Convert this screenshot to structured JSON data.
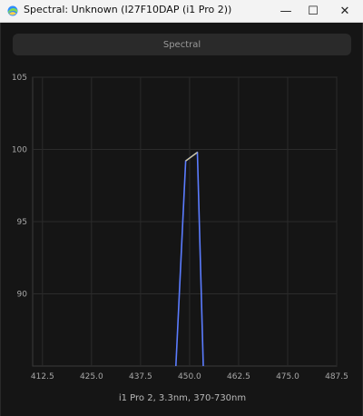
{
  "window": {
    "title": "Spectral: Unknown (I27F10DAP (i1 Pro 2))",
    "minimize_glyph": "—",
    "maximize_glyph": "☐",
    "close_glyph": "✕"
  },
  "toolbar": {
    "spectral_label": "Spectral"
  },
  "colors": {
    "series_main": "#5b7cff",
    "series_peak": "#e6d27a",
    "grid": "#2b2b2b",
    "axis_frame": "#3a3a3a"
  },
  "chart_data": {
    "type": "line",
    "xlabel": "i1 Pro 2, 3.3nm, 370-730nm",
    "xlim": [
      410.0,
      487.5
    ],
    "ylim": [
      85,
      105
    ],
    "xticks": [
      "412.5",
      "425.0",
      "437.5",
      "450.0",
      "462.5",
      "475.0",
      "487.5"
    ],
    "yticks": [
      "90",
      "95",
      "100",
      "105"
    ],
    "grid": true,
    "series": [
      {
        "x": [
          446.5,
          449.0,
          452.0,
          453.5
        ],
        "y": [
          85,
          99.2,
          99.8,
          85
        ]
      },
      {
        "x": [
          449.0,
          452.0
        ],
        "y": [
          99.2,
          99.8
        ]
      }
    ]
  }
}
